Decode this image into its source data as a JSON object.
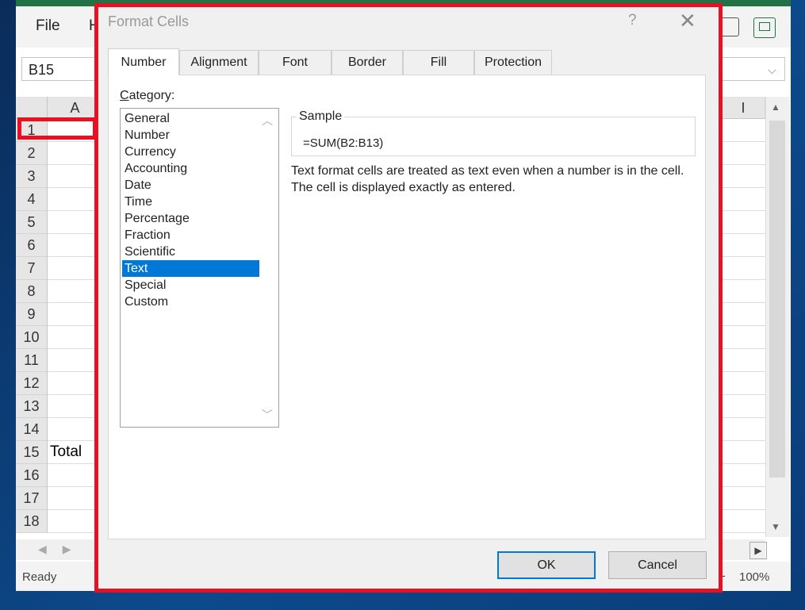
{
  "excel": {
    "ribbon_tabs": [
      "File",
      "H"
    ],
    "name_box": "B15",
    "columns": [
      "A",
      "I"
    ],
    "rows": [
      "1",
      "2",
      "3",
      "4",
      "5",
      "6",
      "7",
      "8",
      "9",
      "10",
      "11",
      "12",
      "13",
      "14",
      "15",
      "16",
      "17",
      "18"
    ],
    "cell_a15": "Total",
    "status": "Ready",
    "zoom_plus": "+",
    "zoom": "100%"
  },
  "dialog": {
    "title": "Format Cells",
    "help": "?",
    "close": "✕",
    "tabs": [
      "Number",
      "Alignment",
      "Font",
      "Border",
      "Fill",
      "Protection"
    ],
    "active_tab": "Number",
    "category_label_prefix": "C",
    "category_label_rest": "ategory:",
    "categories": [
      "General",
      "Number",
      "Currency",
      "Accounting",
      "Date",
      "Time",
      "Percentage",
      "Fraction",
      "Scientific",
      "Text",
      "Special",
      "Custom"
    ],
    "selected_category": "Text",
    "highlighted_category": "Number",
    "sample_label": "Sample",
    "sample_value": "=SUM(B2:B13)",
    "description": "Text format cells are treated as text even when a number is in the cell.  The cell is displayed exactly as entered.",
    "ok_label": "OK",
    "cancel_label": "Cancel"
  },
  "colors": {
    "highlight": "#e81123",
    "selection": "#0078d7",
    "excel_green": "#217346"
  }
}
